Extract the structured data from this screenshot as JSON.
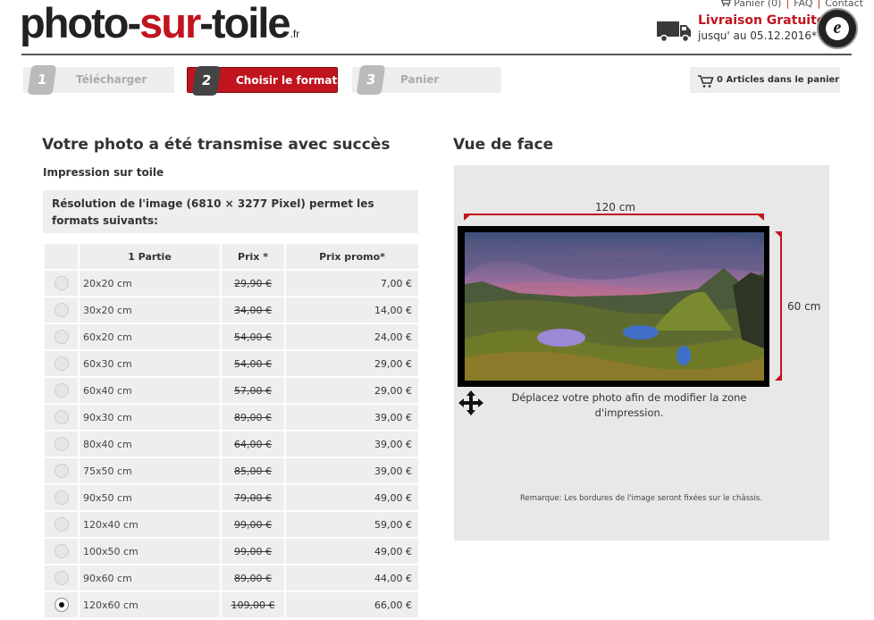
{
  "header": {
    "logo_part1": "photo-",
    "logo_part2": "sur",
    "logo_part3": "-toile",
    "logo_tld": ".fr",
    "links": {
      "cart": "Panier (0)",
      "faq": "FAQ",
      "contact": "Contact"
    },
    "shipping_title": "Livraison Gratuite",
    "shipping_sub": "jusqu' au 05.12.2016*",
    "seal_letter": "e",
    "truck_icon": "truck-icon",
    "seal_icon": "trusted-shops-seal"
  },
  "steps": [
    {
      "num": "1",
      "label": "Télécharger",
      "active": false
    },
    {
      "num": "2",
      "label": "Choisir le format",
      "active": true
    },
    {
      "num": "3",
      "label": "Panier",
      "active": false
    }
  ],
  "cart_summary": {
    "icon": "cart-icon",
    "label": "0 Articles dans le panier"
  },
  "left": {
    "title": "Votre photo a été transmise avec succès",
    "subtitle": "Impression sur toile",
    "resolution_text": "Résolution de l'image (6810 × 3277 Pixel) permet les formats suivants:",
    "table": {
      "headers": [
        "",
        "1 Partie",
        "Prix *",
        "Prix promo*"
      ],
      "rows": [
        {
          "size": "20x20 cm",
          "price": "29,90 €",
          "promo": "7,00 €",
          "selected": false
        },
        {
          "size": "30x20 cm",
          "price": "34,00 €",
          "promo": "14,00 €",
          "selected": false
        },
        {
          "size": "60x20 cm",
          "price": "54,00 €",
          "promo": "24,00 €",
          "selected": false
        },
        {
          "size": "60x30 cm",
          "price": "54,00 €",
          "promo": "29,00 €",
          "selected": false
        },
        {
          "size": "60x40 cm",
          "price": "57,00 €",
          "promo": "29,00 €",
          "selected": false
        },
        {
          "size": "90x30 cm",
          "price": "89,00 €",
          "promo": "39,00 €",
          "selected": false
        },
        {
          "size": "80x40 cm",
          "price": "64,00 €",
          "promo": "39,00 €",
          "selected": false
        },
        {
          "size": "75x50 cm",
          "price": "85,00 €",
          "promo": "39,00 €",
          "selected": false
        },
        {
          "size": "90x50 cm",
          "price": "79,00 €",
          "promo": "49,00 €",
          "selected": false
        },
        {
          "size": "120x40 cm",
          "price": "99,00 €",
          "promo": "59,00 €",
          "selected": false
        },
        {
          "size": "100x50 cm",
          "price": "99,00 €",
          "promo": "49,00 €",
          "selected": false
        },
        {
          "size": "90x60 cm",
          "price": "89,00 €",
          "promo": "44,00 €",
          "selected": false
        },
        {
          "size": "120x60 cm",
          "price": "109,00 €",
          "promo": "66,00 €",
          "selected": true
        }
      ]
    }
  },
  "right": {
    "title": "Vue de face",
    "width_label": "120 cm",
    "height_label": "60 cm",
    "move_icon": "move-arrows-icon",
    "move_text": "Déplacez votre photo afin de modifier la zone d'impression.",
    "remark": "Remarque: Les bordures de l'image seront fixées sur le châssis."
  },
  "colors": {
    "brand_red": "#c0141f",
    "step_gray": "#eeeeee",
    "preview_bg": "#e8e8e8"
  }
}
